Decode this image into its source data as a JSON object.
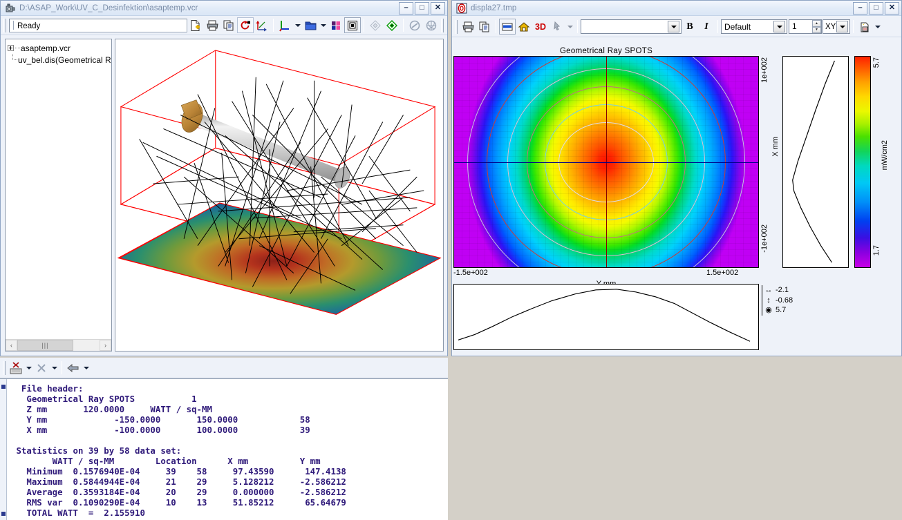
{
  "main_window": {
    "title": "D:\\ASAP_Work\\UV_C_Desinfektion\\asaptemp.vcr",
    "icon": "camera-icon",
    "buttons": {
      "minimize": "–",
      "maximize": "□",
      "close": "✕"
    },
    "status": "Ready",
    "toolbar": [
      {
        "name": "new-document-icon",
        "label": "New"
      },
      {
        "name": "print-icon",
        "label": "Print"
      },
      {
        "name": "copy-icon",
        "label": "Copy"
      },
      {
        "name": "rotate-icon",
        "label": "Rotate"
      },
      {
        "name": "axis-flip-icon",
        "label": "Flip Axes"
      },
      {
        "name": "axes-icon",
        "label": "Axes"
      },
      {
        "name": "folder-icon",
        "label": "Open View"
      },
      {
        "name": "palette-icon",
        "label": "Colors"
      },
      {
        "name": "box-icon",
        "label": "Bounding Box"
      },
      {
        "name": "diamond-outline-icon",
        "label": "Wireframe"
      },
      {
        "name": "diamond-filled-icon",
        "label": "Shaded"
      },
      {
        "name": "disabled-slash-icon",
        "label": "Disabled"
      },
      {
        "name": "globe-icon",
        "label": "Globe"
      }
    ],
    "tree": [
      {
        "label": "asaptemp.vcr",
        "expandable": true
      },
      {
        "label": "uv_bel.dis(Geometrical R",
        "expandable": false
      }
    ],
    "scrollbar": {
      "left_arrow": "‹",
      "right_arrow": "›",
      "thumb_grip": "|||"
    }
  },
  "mid_toolbar": [
    {
      "name": "clear-console-icon",
      "label": "Clear"
    },
    {
      "name": "delete-icon",
      "label": "Delete"
    },
    {
      "name": "enter-icon",
      "label": "Run"
    }
  ],
  "display_window": {
    "title": "displa27.tmp",
    "icon": "target-icon",
    "buttons": {
      "minimize": "–",
      "maximize": "□",
      "close": "✕"
    },
    "toolbar": {
      "icons": [
        {
          "name": "print-icon",
          "label": "Print"
        },
        {
          "name": "copy-icon",
          "label": "Copy"
        },
        {
          "name": "window-icon",
          "label": "Window"
        },
        {
          "name": "home-icon",
          "label": "Home"
        },
        {
          "name": "3d-icon",
          "label": "3D"
        },
        {
          "name": "pointer-icon",
          "label": "Pick"
        }
      ],
      "text_combo": {
        "value": "",
        "placeholder": ""
      },
      "bold": "B",
      "italic": "I",
      "style_combo": "Default",
      "page_spinner": "1",
      "axis_combo": "XY",
      "last_icon": {
        "name": "new-plot-icon",
        "label": "New Plot"
      }
    }
  },
  "chart_data": {
    "type": "heatmap",
    "title": "Geometrical Ray SPOTS",
    "xlabel": "Y mm",
    "ylabel": "X mm",
    "colorbar_label": "mW/cm2",
    "colorbar_min": "1.7",
    "colorbar_max": "5.7",
    "x_tick_min": "-1.5e+002",
    "x_tick_max": "1.5e+002",
    "y_tick_min": "-1e+002",
    "y_tick_max": "1e+002",
    "xlim": [
      -150,
      150
    ],
    "ylim": [
      -100,
      100
    ],
    "zlim": [
      1.7,
      5.7
    ],
    "grid_columns": 58,
    "grid_rows": 39,
    "peak_center": [
      0,
      0
    ],
    "peak_value": 5.7,
    "cursor_readout": [
      {
        "icon": "horizontal-arrows-icon",
        "value": "-2.1"
      },
      {
        "icon": "vertical-arrows-icon",
        "value": "-0.68"
      },
      {
        "icon": "target-dot-icon",
        "value": "5.7"
      }
    ],
    "x_profile": {
      "axis": "X mm",
      "description": "vertical cut profile",
      "values": [
        1.9,
        2.6,
        3.4,
        4.3,
        5.1,
        5.65,
        5.4,
        4.6,
        3.6,
        2.7,
        2.0
      ]
    },
    "y_profile": {
      "axis": "Y mm",
      "description": "horizontal cut profile",
      "values": [
        1.75,
        2.2,
        2.9,
        3.8,
        4.7,
        5.4,
        5.7,
        5.65,
        5.2,
        4.4,
        3.4,
        2.5,
        1.9
      ]
    },
    "contour_levels": [
      {
        "value": 5.0,
        "color": "#c8c8d8"
      },
      {
        "value": 4.4,
        "color": "#6fd0e8"
      },
      {
        "value": 3.7,
        "color": "#c06070"
      },
      {
        "value": 3.0,
        "color": "#d8b0c8"
      },
      {
        "value": 2.4,
        "color": "#c03030"
      },
      {
        "value": 1.9,
        "color": "#b0b0c8"
      }
    ],
    "colormap": [
      "#c800e6",
      "#3a0fe2",
      "#0090f8",
      "#12d45a",
      "#eaf800",
      "#ffa000",
      "#ff2000"
    ]
  },
  "viewport_3d": {
    "description": "UV-C lamp ray trace with irradiance map",
    "bounding_box_color": "#ff0000",
    "lamp_color": "#c9c9c9",
    "lamp_cap_color": "#c89a4a",
    "ray_color": "#000000"
  },
  "console": {
    "text": "  File header:\n   Geometrical Ray SPOTS           1\n   Z mm       120.0000     WATT / sq-MM\n   Y mm             -150.0000       150.0000            58\n   X mm             -100.0000       100.0000            39\n\n Statistics on 39 by 58 data set:\n        WATT / sq-MM        Location      X mm          Y mm\n   Minimum  0.1576940E-04     39    58     97.43590      147.4138\n   Maximum  0.5844944E-04     21    29     5.128212     -2.586212\n   Average  0.3593184E-04     20    29     0.000000     -2.586212\n   RMS var  0.1090290E-04     10    13     51.85212      65.64679\n   TOTAL WATT  =  2.155910"
  }
}
